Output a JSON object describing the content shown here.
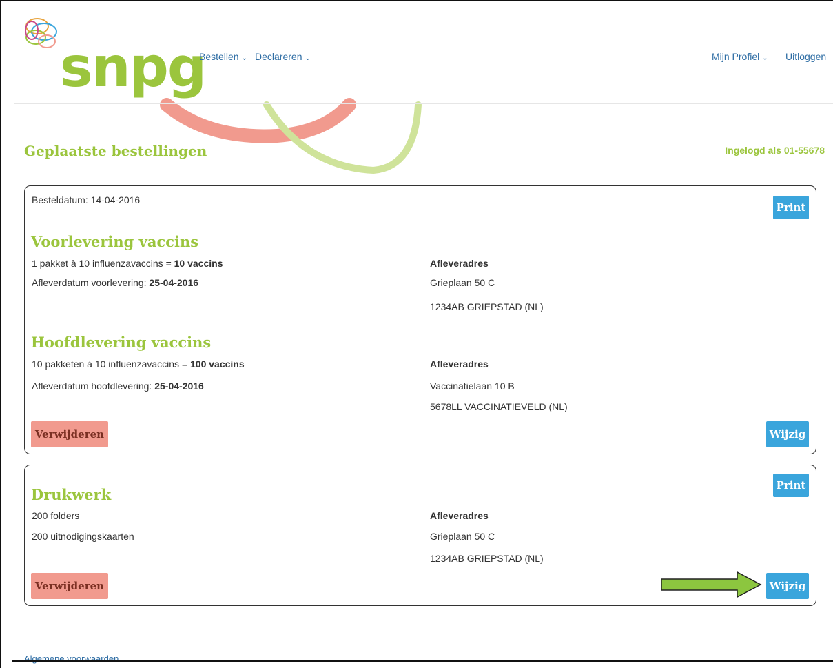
{
  "colors": {
    "brand_green": "#9bc53d",
    "brand_green_light": "#cfe39a",
    "salmon": "#f19a8e",
    "link_blue": "#2e6da4",
    "button_blue": "#3aa5dc",
    "arrow_green": "#8cc63f"
  },
  "logo": {
    "text": "snpg"
  },
  "nav": {
    "bestellen": "Bestellen",
    "declareren": "Declareren",
    "profiel": "Mijn Profiel",
    "uitloggen": "Uitloggen",
    "chevron": "⌄"
  },
  "page": {
    "title": "Geplaatste bestellingen",
    "logged_in": "Ingelogd als 01-55678"
  },
  "order1": {
    "date_label": "Besteldatum: 14-04-2016",
    "print": "Print",
    "voor": {
      "title": "Voorlevering vaccins",
      "qty_prefix": "1 pakket à 10 influenzavaccins = ",
      "qty_bold": "10 vaccins",
      "date_prefix": "Afleverdatum voorlevering: ",
      "date_bold": "25-04-2016",
      "addr_label": "Afleveradres",
      "addr_line1": "Grieplaan 50 C",
      "addr_line2": "1234AB GRIEPSTAD (NL)"
    },
    "hoofd": {
      "title": "Hoofdlevering vaccins",
      "qty_prefix": "10 pakketen à 10 influenzavaccins = ",
      "qty_bold": "100 vaccins",
      "date_prefix": "Afleverdatum hoofdlevering: ",
      "date_bold": "25-04-2016",
      "addr_label": "Afleveradres",
      "addr_line1": "Vaccinatielaan 10 B",
      "addr_line2": "5678LL VACCINATIEVELD (NL)"
    },
    "delete": "Verwijderen",
    "edit": "Wijzig"
  },
  "order2": {
    "print": "Print",
    "title": "Drukwerk",
    "item1": "200 folders",
    "item2": "200 uitnodigingskaarten",
    "addr_label": "Afleveradres",
    "addr_line1": "Grieplaan 50 C",
    "addr_line2": "1234AB GRIEPSTAD (NL)",
    "delete": "Verwijderen",
    "edit": "Wijzig"
  },
  "footer": {
    "terms": "Algemene voorwaarden"
  },
  "icons": {
    "logo_rings": "snpg-rings-icon",
    "arrow": "green-arrow-icon"
  }
}
